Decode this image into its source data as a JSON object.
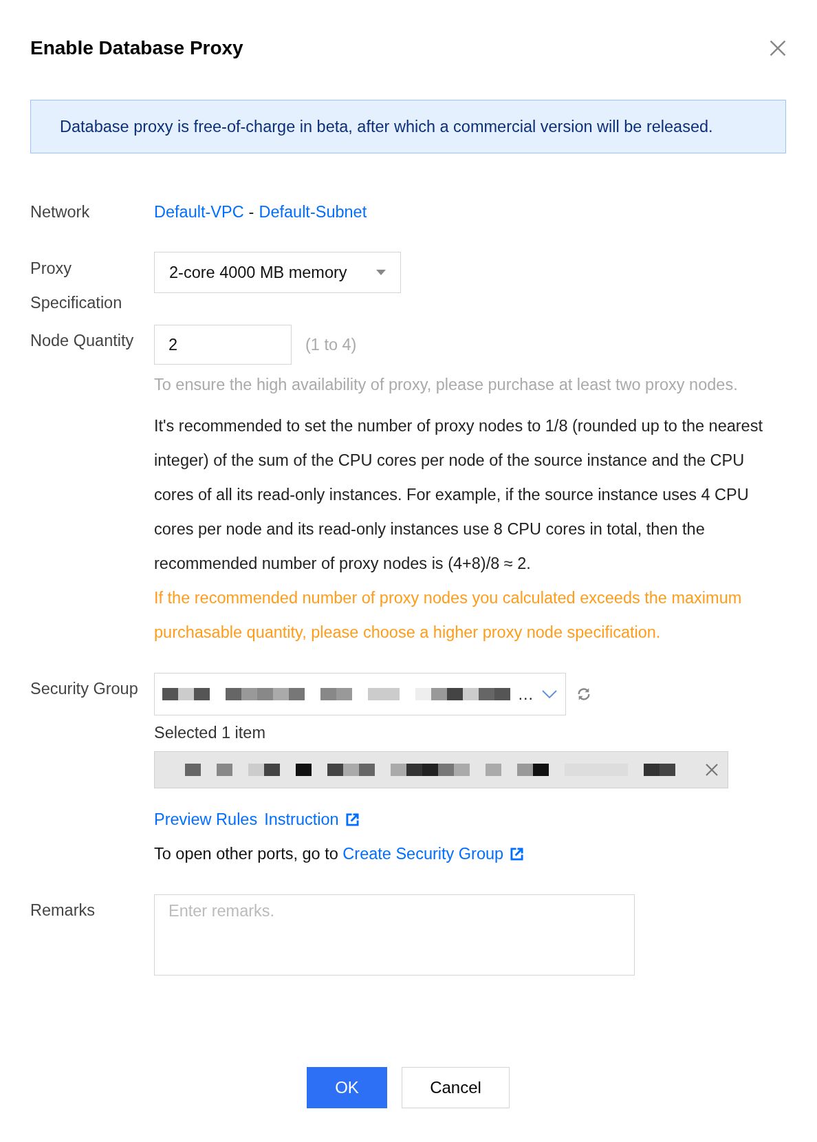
{
  "dialog": {
    "title": "Enable Database Proxy"
  },
  "notice": {
    "text": "Database proxy is free-of-charge in beta, after which a commercial version will be released."
  },
  "form": {
    "network": {
      "label": "Network",
      "vpc": "Default-VPC",
      "separator": "-",
      "subnet": "Default-Subnet"
    },
    "proxy_specification": {
      "label": "Proxy Specification",
      "value": "2-core 4000 MB memory"
    },
    "node_quantity": {
      "label": "Node Quantity",
      "value": "2",
      "range": "(1 to 4)",
      "hint": "To ensure the high availability of proxy, please purchase at least two proxy nodes.",
      "recommendation": "It's recommended to set the number of proxy nodes to 1/8 (rounded up to the nearest integer) of the sum of the CPU cores per node of the source instance and the CPU cores of all its read-only instances. For example, if the source instance uses 4 CPU cores per node and its read-only instances use 8 CPU cores in total, then the recommended number of proxy nodes is (4+8)/8 ≈ 2.",
      "warning": "If the recommended number of proxy nodes you calculated exceeds the maximum purchasable quantity, please choose a higher proxy node specification."
    },
    "security_group": {
      "label": "Security Group",
      "value_ellipsis": "…",
      "selected_count": "Selected 1 item",
      "links": [
        {
          "label": "Preview Rules",
          "external": false
        },
        {
          "label": "Instruction",
          "external": true
        }
      ],
      "ports_note": "To open other ports, go to",
      "create_link": {
        "label": "Create Security Group",
        "external": true
      }
    },
    "remarks": {
      "label": "Remarks",
      "placeholder": "Enter remarks."
    }
  },
  "buttons": [
    {
      "label": "OK",
      "kind": "primary"
    },
    {
      "label": "Cancel",
      "kind": "default"
    }
  ]
}
